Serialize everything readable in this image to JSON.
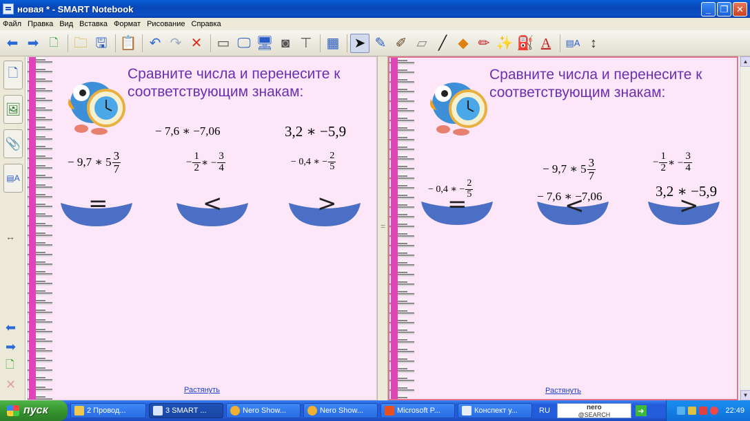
{
  "window": {
    "title": "новая * - SMART Notebook"
  },
  "menu": [
    "Файл",
    "Правка",
    "Вид",
    "Вставка",
    "Формат",
    "Рисование",
    "Справка"
  ],
  "toolbar": {
    "icons": [
      "back-arrow-icon",
      "forward-arrow-icon",
      "add-page-icon",
      "open-folder-icon",
      "save-icon",
      "paste-icon",
      "undo-icon",
      "redo-icon",
      "delete-icon",
      "screen-shade-icon",
      "full-screen-icon",
      "dual-display-icon",
      "screen-capture-icon",
      "document-camera-icon",
      "table-icon",
      "select-pointer-icon",
      "pen-icon",
      "creative-pen-icon",
      "eraser-icon",
      "line-icon",
      "shape-icon",
      "magic-pen-icon",
      "fill-icon",
      "text-icon",
      "properties-icon",
      "toolbar-move-icon"
    ]
  },
  "canvas": {
    "left_page": {
      "heading": "Сравните числа и перенесите к соответствующим знакам:",
      "expr1": "− 7,6 ∗ −7,06",
      "expr2": "3,2 ∗ −5,9",
      "expr3": {
        "pre": "− 9,7 ∗ 5",
        "num": "3",
        "den": "7"
      },
      "expr4": {
        "pre": "−",
        "num1": "1",
        "den1": "2",
        "mid": "∗ −",
        "num2": "3",
        "den2": "4"
      },
      "expr5": {
        "pre": "− 0,4 ∗ −",
        "num": "2",
        "den": "5"
      },
      "signs": [
        "=",
        "<",
        ">"
      ],
      "stretch_link": "Растянуть"
    },
    "right_page": {
      "heading": "Сравните числа и перенесите к соответствующим знакам:",
      "expr_a": {
        "pre": "− 0,4 ∗ −",
        "num": "2",
        "den": "5"
      },
      "expr_b": {
        "pre": "− 9,7 ∗ 5",
        "num": "3",
        "den": "7"
      },
      "expr_c": "− 7,6 ∗ −7,06",
      "expr_d": {
        "pre": "−",
        "num1": "1",
        "den1": "2",
        "mid": "∗ −",
        "num2": "3",
        "den2": "4"
      },
      "expr_e": "3,2 ∗ −5,9",
      "signs": [
        "=",
        "<",
        ">"
      ],
      "stretch_link": "Растянуть"
    }
  },
  "taskbar": {
    "start": "пуск",
    "tasks": [
      "2 Провод...",
      "3 SMART ...",
      "Nero Show...",
      "Nero Show...",
      "Microsoft P...",
      "Конспект у..."
    ],
    "lang": "RU",
    "search_brand": "nero",
    "search_sub": "@SEARCH",
    "clock": "22:49"
  },
  "colors": {
    "heading": "#6a2fb0",
    "page_bg": "#fde6f8",
    "bowl": "#4a6fc4",
    "link": "#1a3fcc"
  }
}
